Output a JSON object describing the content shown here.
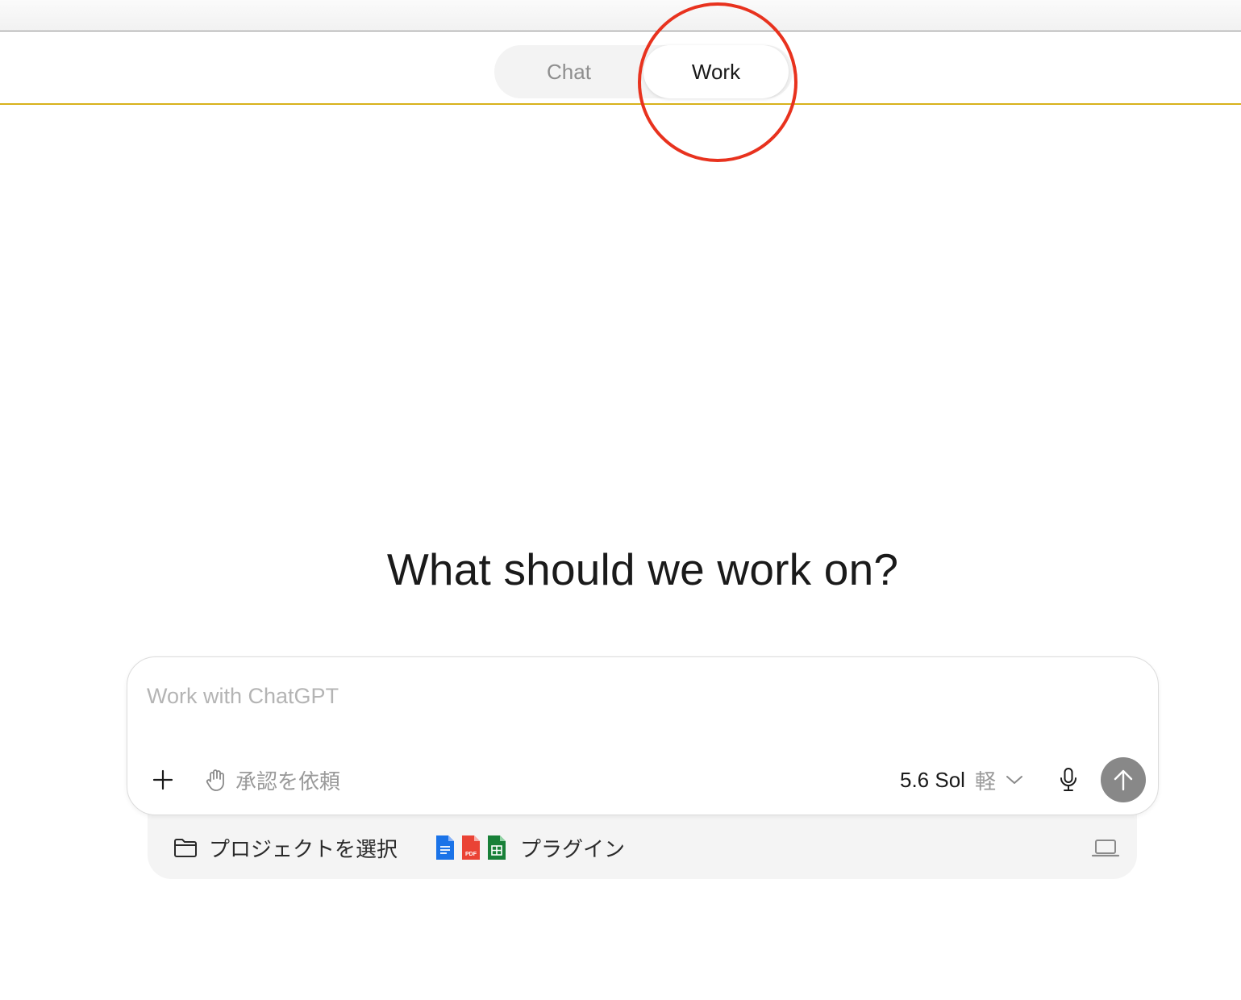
{
  "mode_switch": {
    "tabs": [
      {
        "label": "Chat",
        "selected": false
      },
      {
        "label": "Work",
        "selected": true
      }
    ]
  },
  "main": {
    "heading": "What should we work on?"
  },
  "composer": {
    "placeholder": "Work with ChatGPT",
    "value": "",
    "add_icon": "plus-icon",
    "approval": {
      "icon": "hand-icon",
      "label": "承認を依頼"
    },
    "model": {
      "name": "5.6 Sol",
      "mode": "軽",
      "icon": "chevron-down-icon"
    },
    "mic_icon": "microphone-icon",
    "send_icon": "arrow-up-icon"
  },
  "tray": {
    "project": {
      "icon": "folder-icon",
      "label": "プロジェクトを選択"
    },
    "plugins": {
      "icons": [
        "docs-icon",
        "pdf-icon",
        "sheets-icon"
      ],
      "label": "プラグイン",
      "pdf_badge": "PDF"
    },
    "device_icon": "laptop-icon"
  },
  "colors": {
    "accent_line": "#d8b21c",
    "annotation": "#e8321e",
    "send_button": "#888888",
    "docs": "#1a73e8",
    "pdf": "#ea4335",
    "sheets": "#188038"
  }
}
